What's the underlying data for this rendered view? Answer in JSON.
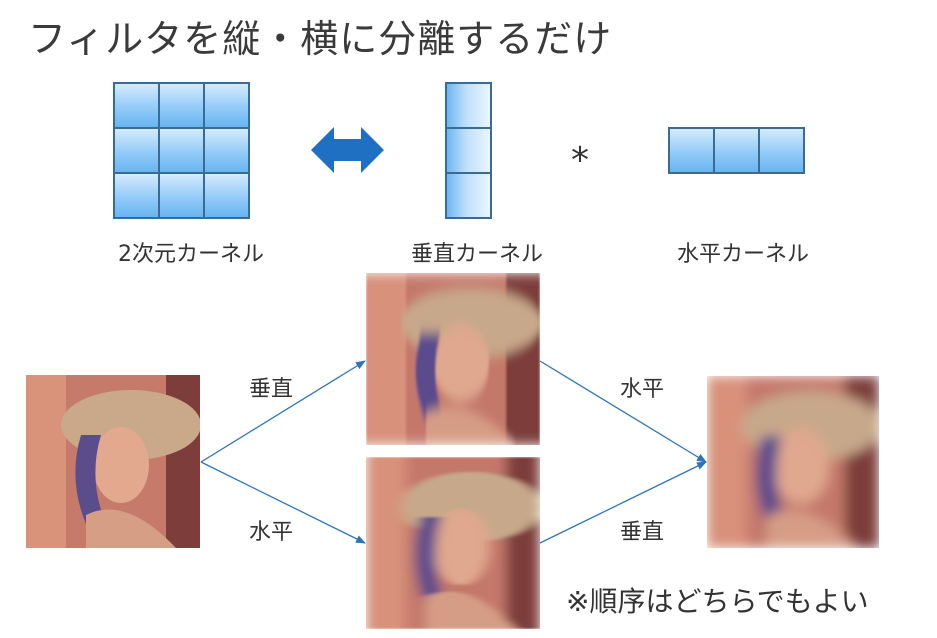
{
  "title": "フィルタを縦・横に分離するだけ",
  "kernels": {
    "two_d_label": "2次元カーネル",
    "vertical_label": "垂直カーネル",
    "horizontal_label": "水平カーネル",
    "convolution_symbol": "*"
  },
  "flow": {
    "top_in_label": "垂直",
    "bottom_in_label": "水平",
    "top_out_label": "水平",
    "bottom_out_label": "垂直"
  },
  "note": "※順序はどちらでもよい",
  "colors": {
    "arrow": "#2e75b6",
    "double_arrow": "#1f6fc2",
    "cell_border": "#3a6b96"
  }
}
